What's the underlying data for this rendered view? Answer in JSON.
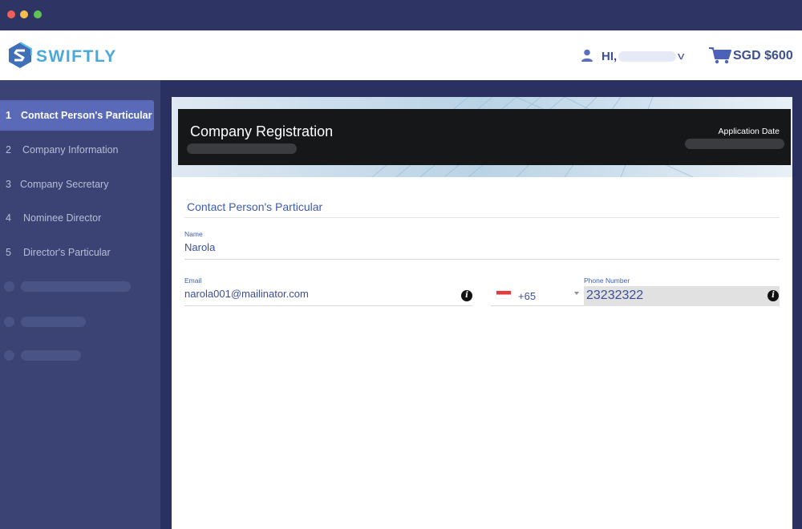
{
  "header": {
    "brand": "SWIFTLY",
    "greeting": "HI,",
    "cart_total": "SGD $600"
  },
  "sidebar": {
    "items": [
      {
        "num": "1",
        "label": "Contact Person's Particular",
        "active": true
      },
      {
        "num": "2",
        "label": "Company Information",
        "active": false
      },
      {
        "num": "3",
        "label": "Company Secretary",
        "active": false
      },
      {
        "num": "4",
        "label": "Nominee Director",
        "active": false
      },
      {
        "num": "5",
        "label": "Director's Particular",
        "active": false
      }
    ]
  },
  "banner": {
    "title": "Company Registration",
    "application_date_label": "Application Date"
  },
  "form": {
    "section_title": "Contact Person's Particular",
    "name_label": "Name",
    "name_value": "Narola",
    "email_label": "Email",
    "email_value": "narola001@mailinator.com",
    "country_code": "+65",
    "phone_label": "Phone Number",
    "phone_value": "23232322"
  },
  "colors": {
    "accent": "#5a69b8",
    "sidebar_bg": "#3a4374",
    "brand": "#4aa9dc",
    "text_primary": "#3d4f94"
  }
}
